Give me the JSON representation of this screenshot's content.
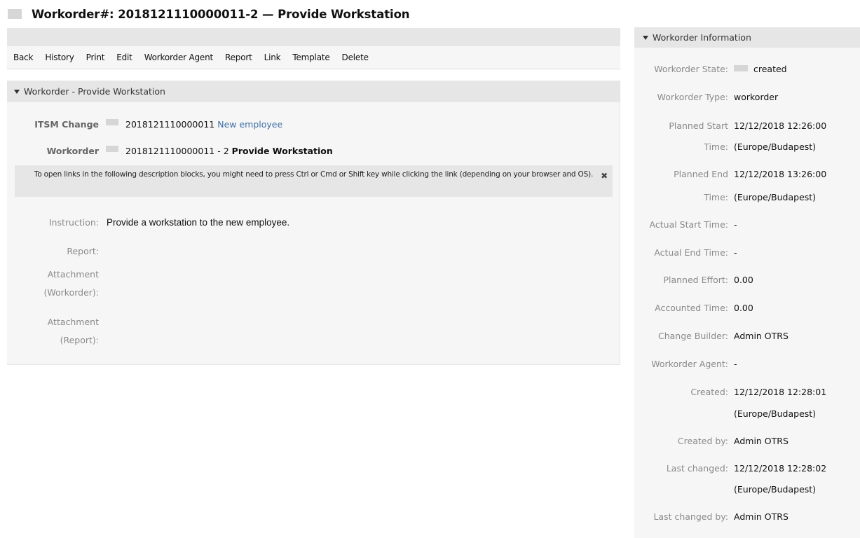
{
  "page": {
    "title": "Workorder#: 2018121110000011-2 — Provide Workstation"
  },
  "menu": {
    "items": [
      "Back",
      "History",
      "Print",
      "Edit",
      "Workorder Agent",
      "Report",
      "Link",
      "Template",
      "Delete"
    ]
  },
  "workorder_widget": {
    "header": "Workorder - Provide Workstation",
    "itsm_change_label": "ITSM Change",
    "itsm_change_number": "2018121110000011",
    "itsm_change_title": "New employee",
    "workorder_label": "Workorder",
    "workorder_number": "2018121110000011 - 2",
    "workorder_title": "Provide Workstation",
    "notice": "To open links in the following description blocks, you might need to press Ctrl or Cmd or Shift key while clicking the link (depending on your browser and OS).",
    "notice_close": "✖",
    "instruction_label": "Instruction:",
    "instruction_value": "Provide a workstation to the new employee.",
    "report_label": "Report:",
    "attachment_workorder_label_1": "Attachment",
    "attachment_workorder_label_2": "(Workorder):",
    "attachment_report_label_1": "Attachment",
    "attachment_report_label_2": "(Report):"
  },
  "info_widget": {
    "header": "Workorder Information",
    "state_label": "Workorder State:",
    "state_value": "created",
    "type_label": "Workorder Type:",
    "type_value": "workorder",
    "planned_start_label_1": "Planned Start",
    "planned_start_label_2": "Time:",
    "planned_start_value_1": "12/12/2018 12:26:00",
    "planned_start_value_2": "(Europe/Budapest)",
    "planned_end_label_1": "Planned End",
    "planned_end_label_2": "Time:",
    "planned_end_value_1": "12/12/2018 13:26:00",
    "planned_end_value_2": "(Europe/Budapest)",
    "actual_start_label": "Actual Start Time:",
    "actual_start_value": "-",
    "actual_end_label": "Actual End Time:",
    "actual_end_value": "-",
    "planned_effort_label": "Planned Effort:",
    "planned_effort_value": "0.00",
    "accounted_time_label": "Accounted Time:",
    "accounted_time_value": "0.00",
    "change_builder_label": "Change Builder:",
    "change_builder_value": "Admin OTRS",
    "workorder_agent_label": "Workorder Agent:",
    "workorder_agent_value": "-",
    "created_label": "Created:",
    "created_value_1": "12/12/2018 12:28:01",
    "created_value_2": "(Europe/Budapest)",
    "created_by_label": "Created by:",
    "created_by_value": "Admin OTRS",
    "last_changed_label": "Last changed:",
    "last_changed_value_1": "12/12/2018 12:28:02",
    "last_changed_value_2": "(Europe/Budapest)",
    "last_changed_by_label": "Last changed by:",
    "last_changed_by_value": "Admin OTRS"
  }
}
